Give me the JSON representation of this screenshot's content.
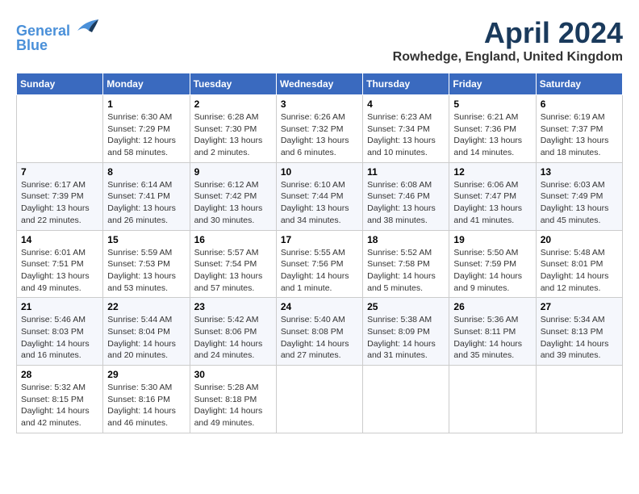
{
  "header": {
    "logo_line1": "General",
    "logo_line2": "Blue",
    "month_title": "April 2024",
    "location": "Rowhedge, England, United Kingdom"
  },
  "days_of_week": [
    "Sunday",
    "Monday",
    "Tuesday",
    "Wednesday",
    "Thursday",
    "Friday",
    "Saturday"
  ],
  "weeks": [
    [
      {
        "day": "",
        "info": ""
      },
      {
        "day": "1",
        "info": "Sunrise: 6:30 AM\nSunset: 7:29 PM\nDaylight: 12 hours\nand 58 minutes."
      },
      {
        "day": "2",
        "info": "Sunrise: 6:28 AM\nSunset: 7:30 PM\nDaylight: 13 hours\nand 2 minutes."
      },
      {
        "day": "3",
        "info": "Sunrise: 6:26 AM\nSunset: 7:32 PM\nDaylight: 13 hours\nand 6 minutes."
      },
      {
        "day": "4",
        "info": "Sunrise: 6:23 AM\nSunset: 7:34 PM\nDaylight: 13 hours\nand 10 minutes."
      },
      {
        "day": "5",
        "info": "Sunrise: 6:21 AM\nSunset: 7:36 PM\nDaylight: 13 hours\nand 14 minutes."
      },
      {
        "day": "6",
        "info": "Sunrise: 6:19 AM\nSunset: 7:37 PM\nDaylight: 13 hours\nand 18 minutes."
      }
    ],
    [
      {
        "day": "7",
        "info": "Sunrise: 6:17 AM\nSunset: 7:39 PM\nDaylight: 13 hours\nand 22 minutes."
      },
      {
        "day": "8",
        "info": "Sunrise: 6:14 AM\nSunset: 7:41 PM\nDaylight: 13 hours\nand 26 minutes."
      },
      {
        "day": "9",
        "info": "Sunrise: 6:12 AM\nSunset: 7:42 PM\nDaylight: 13 hours\nand 30 minutes."
      },
      {
        "day": "10",
        "info": "Sunrise: 6:10 AM\nSunset: 7:44 PM\nDaylight: 13 hours\nand 34 minutes."
      },
      {
        "day": "11",
        "info": "Sunrise: 6:08 AM\nSunset: 7:46 PM\nDaylight: 13 hours\nand 38 minutes."
      },
      {
        "day": "12",
        "info": "Sunrise: 6:06 AM\nSunset: 7:47 PM\nDaylight: 13 hours\nand 41 minutes."
      },
      {
        "day": "13",
        "info": "Sunrise: 6:03 AM\nSunset: 7:49 PM\nDaylight: 13 hours\nand 45 minutes."
      }
    ],
    [
      {
        "day": "14",
        "info": "Sunrise: 6:01 AM\nSunset: 7:51 PM\nDaylight: 13 hours\nand 49 minutes."
      },
      {
        "day": "15",
        "info": "Sunrise: 5:59 AM\nSunset: 7:53 PM\nDaylight: 13 hours\nand 53 minutes."
      },
      {
        "day": "16",
        "info": "Sunrise: 5:57 AM\nSunset: 7:54 PM\nDaylight: 13 hours\nand 57 minutes."
      },
      {
        "day": "17",
        "info": "Sunrise: 5:55 AM\nSunset: 7:56 PM\nDaylight: 14 hours\nand 1 minute."
      },
      {
        "day": "18",
        "info": "Sunrise: 5:52 AM\nSunset: 7:58 PM\nDaylight: 14 hours\nand 5 minutes."
      },
      {
        "day": "19",
        "info": "Sunrise: 5:50 AM\nSunset: 7:59 PM\nDaylight: 14 hours\nand 9 minutes."
      },
      {
        "day": "20",
        "info": "Sunrise: 5:48 AM\nSunset: 8:01 PM\nDaylight: 14 hours\nand 12 minutes."
      }
    ],
    [
      {
        "day": "21",
        "info": "Sunrise: 5:46 AM\nSunset: 8:03 PM\nDaylight: 14 hours\nand 16 minutes."
      },
      {
        "day": "22",
        "info": "Sunrise: 5:44 AM\nSunset: 8:04 PM\nDaylight: 14 hours\nand 20 minutes."
      },
      {
        "day": "23",
        "info": "Sunrise: 5:42 AM\nSunset: 8:06 PM\nDaylight: 14 hours\nand 24 minutes."
      },
      {
        "day": "24",
        "info": "Sunrise: 5:40 AM\nSunset: 8:08 PM\nDaylight: 14 hours\nand 27 minutes."
      },
      {
        "day": "25",
        "info": "Sunrise: 5:38 AM\nSunset: 8:09 PM\nDaylight: 14 hours\nand 31 minutes."
      },
      {
        "day": "26",
        "info": "Sunrise: 5:36 AM\nSunset: 8:11 PM\nDaylight: 14 hours\nand 35 minutes."
      },
      {
        "day": "27",
        "info": "Sunrise: 5:34 AM\nSunset: 8:13 PM\nDaylight: 14 hours\nand 39 minutes."
      }
    ],
    [
      {
        "day": "28",
        "info": "Sunrise: 5:32 AM\nSunset: 8:15 PM\nDaylight: 14 hours\nand 42 minutes."
      },
      {
        "day": "29",
        "info": "Sunrise: 5:30 AM\nSunset: 8:16 PM\nDaylight: 14 hours\nand 46 minutes."
      },
      {
        "day": "30",
        "info": "Sunrise: 5:28 AM\nSunset: 8:18 PM\nDaylight: 14 hours\nand 49 minutes."
      },
      {
        "day": "",
        "info": ""
      },
      {
        "day": "",
        "info": ""
      },
      {
        "day": "",
        "info": ""
      },
      {
        "day": "",
        "info": ""
      }
    ]
  ]
}
